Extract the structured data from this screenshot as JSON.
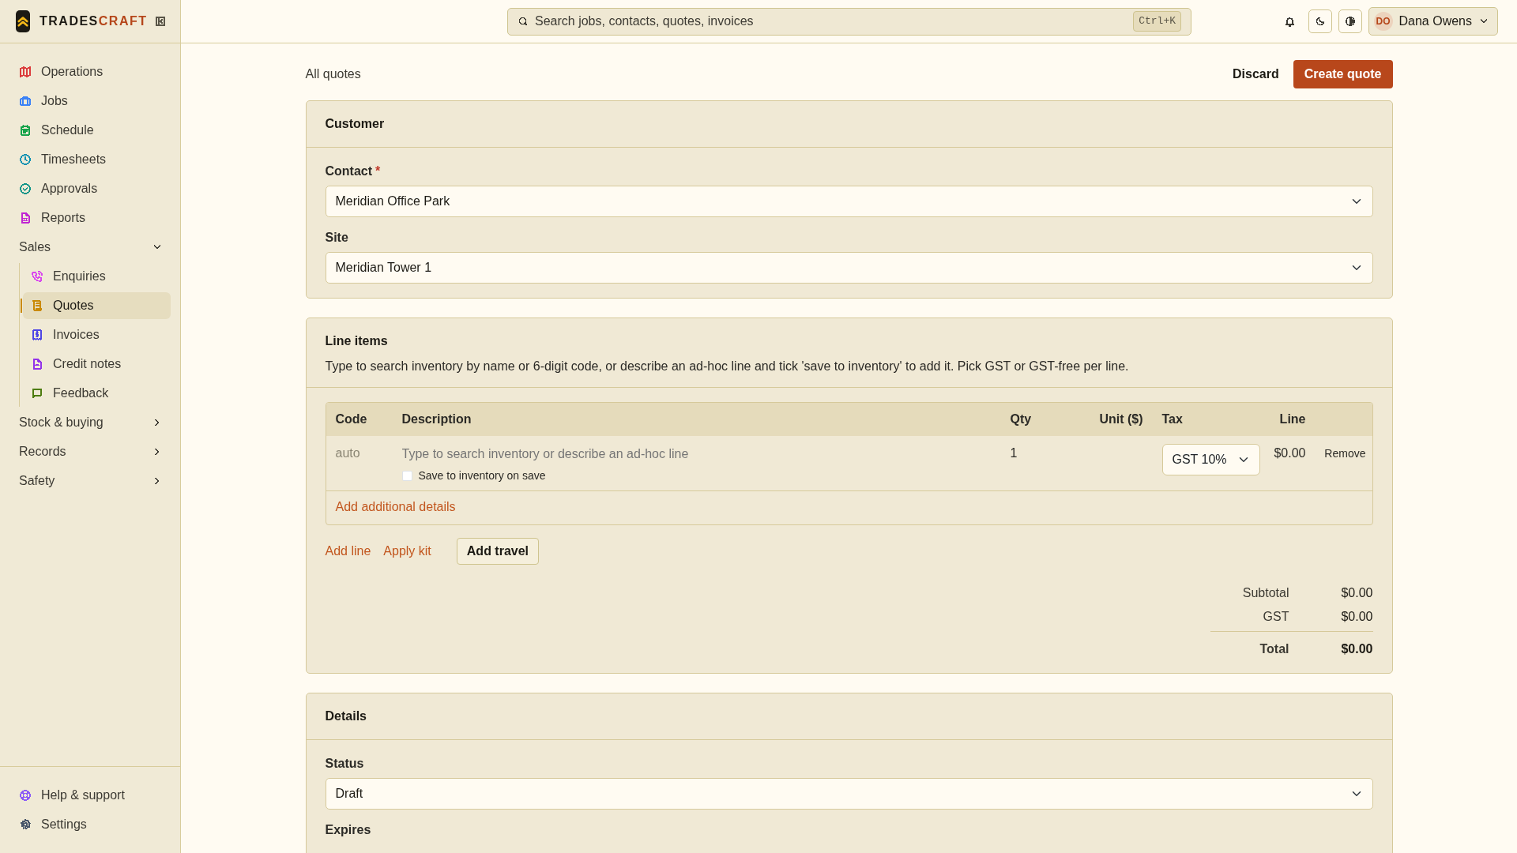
{
  "brand": {
    "part1": "TRADES",
    "part2": "CRAFT"
  },
  "sidebar": {
    "items": [
      {
        "kind": "link",
        "label": "Operations",
        "color": "#dc3c3c",
        "selected": false
      },
      {
        "kind": "link",
        "label": "Jobs",
        "color": "#3b82f6",
        "selected": false
      },
      {
        "kind": "link",
        "label": "Schedule",
        "color": "#16a34a",
        "selected": false
      },
      {
        "kind": "link",
        "label": "Timesheets",
        "color": "#0891b2",
        "selected": false
      },
      {
        "kind": "link",
        "label": "Approvals",
        "color": "#0d9488",
        "selected": false
      },
      {
        "kind": "link",
        "label": "Reports",
        "color": "#c026d3",
        "selected": false
      },
      {
        "kind": "group",
        "label": "Sales",
        "expanded": true,
        "children": [
          {
            "label": "Enquiries",
            "color": "#d946ef",
            "selected": false
          },
          {
            "label": "Quotes",
            "color": "#ca8a04",
            "selected": true
          },
          {
            "label": "Invoices",
            "color": "#4f46e5",
            "selected": false
          },
          {
            "label": "Credit notes",
            "color": "#9333ea",
            "selected": false
          },
          {
            "label": "Feedback",
            "color": "#4d7c0f",
            "selected": false
          }
        ]
      },
      {
        "kind": "group",
        "label": "Stock & buying",
        "expanded": false
      },
      {
        "kind": "group",
        "label": "Records",
        "expanded": false
      },
      {
        "kind": "group",
        "label": "Safety",
        "expanded": false
      }
    ],
    "footer": [
      {
        "label": "Help & support",
        "color": "#8b5cf6"
      },
      {
        "label": "Settings",
        "color": "#475569"
      }
    ]
  },
  "topbar": {
    "search": {
      "placeholder": "Search jobs, contacts, quotes, invoices",
      "shortcut": "Ctrl+K"
    },
    "user": {
      "initials": "DO",
      "name": "Dana Owens"
    }
  },
  "page": {
    "breadcrumb": "All quotes",
    "buttons": [
      {
        "kind": "plain",
        "label": "Discard"
      },
      {
        "kind": "primary",
        "label": "Create quote"
      }
    ]
  },
  "customer": {
    "title": "Customer",
    "fields": [
      {
        "label": "Contact",
        "required_mark": "*",
        "value": "Meridian Office Park"
      },
      {
        "label": "Site",
        "value": "Meridian Tower 1"
      }
    ]
  },
  "line_items": {
    "title": "Line items",
    "description": "Type to search inventory by name or 6-digit code, or describe an ad-hoc line and tick 'save to inventory' to add it. Pick GST or GST-free per line.",
    "table": {
      "columns": [
        "Code",
        "Description",
        "Qty",
        "Unit ($)",
        "Tax",
        "Line"
      ],
      "rows": [
        {
          "code": "auto",
          "description_placeholder": "Type to search inventory or describe an ad-hoc line",
          "save_label": "Save to inventory on save",
          "save_checked": false,
          "qty": "1",
          "tax": "GST 10%",
          "line": "$0.00",
          "remove": "Remove",
          "details_link": "Add additional details"
        }
      ]
    },
    "actions": [
      {
        "kind": "link",
        "label": "Add line"
      },
      {
        "kind": "link",
        "label": "Apply kit"
      },
      {
        "kind": "button",
        "label": "Add travel"
      }
    ],
    "totals": [
      {
        "kind": "normal",
        "label": "Subtotal",
        "value": "$0.00"
      },
      {
        "kind": "normal",
        "label": "GST",
        "value": "$0.00"
      },
      {
        "kind": "total",
        "label": "Total",
        "value": "$0.00"
      }
    ]
  },
  "details": {
    "title": "Details",
    "fields": [
      {
        "label": "Status",
        "value": "Draft"
      }
    ],
    "next_label": "Expires"
  }
}
